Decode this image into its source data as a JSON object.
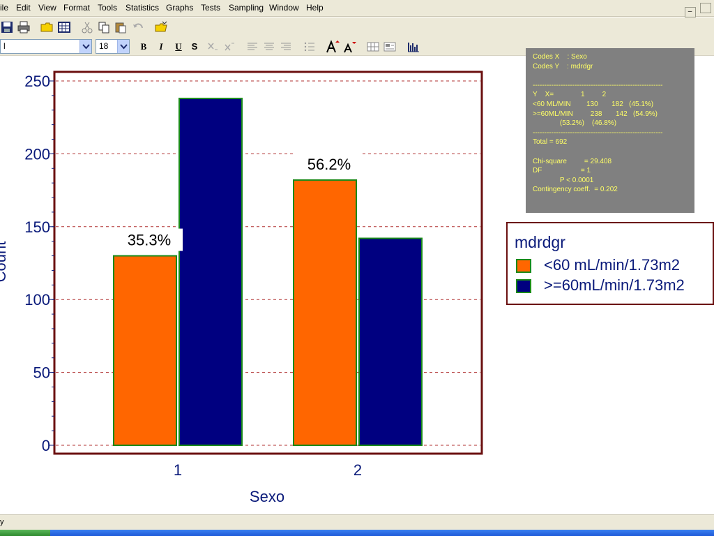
{
  "menu": [
    "ile",
    "Edit",
    "View",
    "Format",
    "Tools",
    "Statistics",
    "Graphs",
    "Tests",
    "Sampling",
    "Window",
    "Help"
  ],
  "window_buttons": [
    "–",
    ""
  ],
  "toolbar2": {
    "font_value": "l",
    "size_value": "18",
    "bold": "B",
    "italic": "I",
    "underline": "U",
    "strike": "S"
  },
  "stats_panel": [
    "Codes X    : Sexo",
    "Codes Y    : mdrdgr",
    "",
    "--------------------------------------------------------",
    "Y    X=              1         2",
    "<60 ML/MIN        130       182   (45.1%)",
    ">=60ML/MIN         238       142   (54.9%)",
    "              (53.2%)    (46.8%)",
    "--------------------------------------------------------",
    "Total = 692",
    "",
    "Chi-square         = 29.408",
    "DF                    = 1",
    "              P < 0.0001",
    "Contingency coeff.  = 0.202"
  ],
  "legend": {
    "title": "mdrdgr",
    "items": [
      {
        "label": "<60 mL/min/1.73m2",
        "color": "#ff6600"
      },
      {
        "label": ">=60mL/min/1.73m2",
        "color": "#000080"
      }
    ]
  },
  "colors": {
    "series1": "#ff6600",
    "series2": "#000080",
    "bar_border": "#1a8a1a",
    "plot_frame": "#6b1010",
    "grid": "#b03030",
    "axis_text": "#0a1a7a"
  },
  "chart_data": {
    "type": "bar",
    "categories": [
      "1",
      "2"
    ],
    "series": [
      {
        "name": "<60 mL/min/1.73m2",
        "values": [
          130,
          182
        ]
      },
      {
        "name": ">=60mL/min/1.73m2",
        "values": [
          238,
          142
        ]
      }
    ],
    "annotations": [
      "35.3%",
      "56.2%"
    ],
    "xlabel": "Sexo",
    "ylabel": "Count",
    "ylim": [
      0,
      250
    ],
    "yticks": [
      0,
      50,
      100,
      150,
      200,
      250
    ],
    "grid": true
  },
  "statusbar": {
    "text": "y"
  }
}
